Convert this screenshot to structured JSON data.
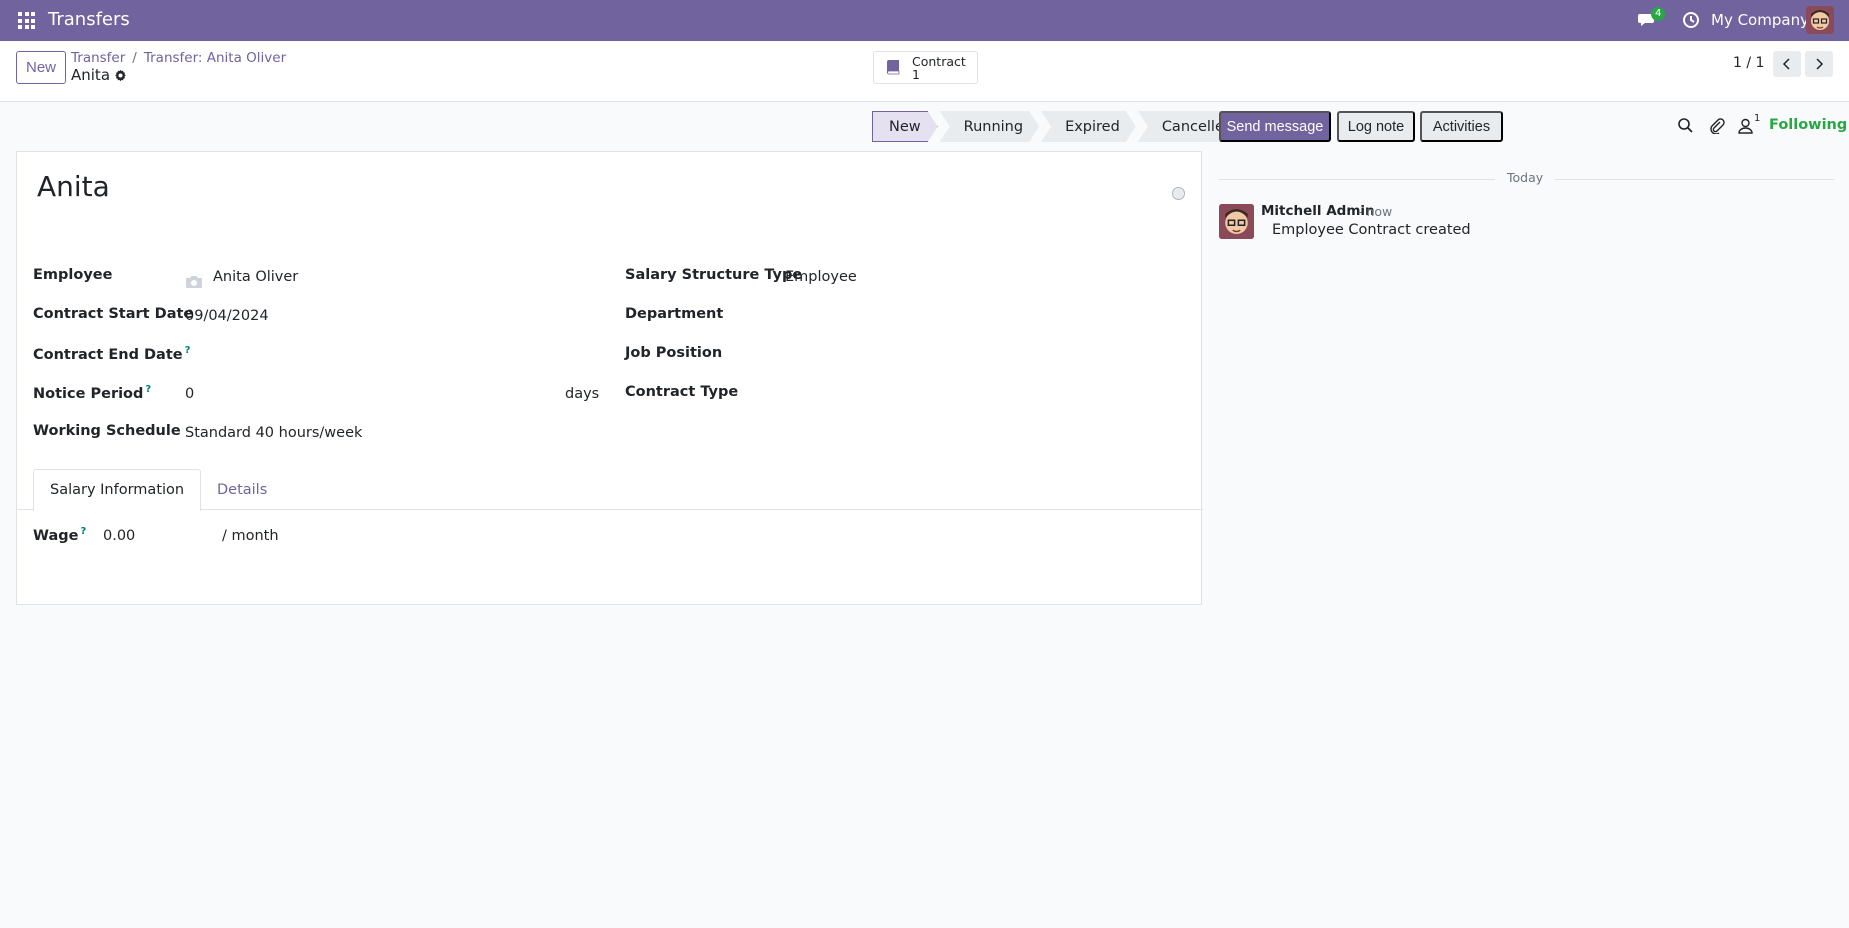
{
  "navbar": {
    "app_title": "Transfers",
    "chat_badge": "4",
    "company": "My Company"
  },
  "control_panel": {
    "new_label": "New",
    "breadcrumb": [
      "Transfer",
      "Transfer: Anita Oliver"
    ],
    "record_name": "Anita",
    "smart_button": {
      "label": "Contract",
      "count": "1"
    },
    "pager": "1 / 1"
  },
  "statusbar": {
    "stages": [
      "New",
      "Running",
      "Expired",
      "Cancelled"
    ],
    "active": "New"
  },
  "form": {
    "title": "Anita",
    "left_fields": [
      {
        "label": "Employee",
        "value": "Anita Oliver"
      },
      {
        "label": "Contract Start Date",
        "value": "09/04/2024"
      },
      {
        "label": "Contract End Date",
        "value": ""
      },
      {
        "label": "Notice Period",
        "value": "0",
        "suffix": "days"
      },
      {
        "label": "Working Schedule",
        "value": "Standard 40 hours/week"
      }
    ],
    "right_fields": [
      {
        "label": "Salary Structure Type",
        "value": "Employee"
      },
      {
        "label": "Department",
        "value": ""
      },
      {
        "label": "Job Position",
        "value": ""
      },
      {
        "label": "Contract Type",
        "value": ""
      }
    ],
    "help_marker": "?",
    "tabs": [
      "Salary Information",
      "Details"
    ],
    "wage": {
      "label": "Wage",
      "value": "0.00",
      "suffix": "/ month"
    }
  },
  "chatter": {
    "send_message": "Send message",
    "log_note": "Log note",
    "activities": "Activities",
    "follower_count": "1",
    "following": "Following",
    "date_separator": "Today",
    "message": {
      "author": "Mitchell Admin",
      "time": "- now",
      "body": "Employee Contract created"
    }
  },
  "colors": {
    "brand": "#71639e",
    "success": "#28a745",
    "help": "#017e84"
  }
}
